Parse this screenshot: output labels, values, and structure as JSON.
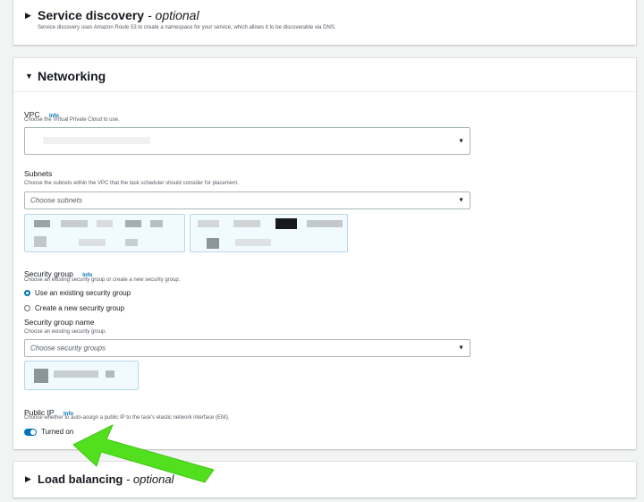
{
  "service_discovery": {
    "title": "Service discovery",
    "optional": "- optional",
    "description": "Service discovery uses Amazon Route 53 to create a namespace for your service, which allows it to be discoverable via DNS."
  },
  "networking": {
    "title": "Networking",
    "vpc": {
      "label": "VPC",
      "info": "Info",
      "description": "Choose the Virtual Private Cloud to use.",
      "value": ""
    },
    "subnets": {
      "label": "Subnets",
      "description": "Choose the subnets within the VPC that the task scheduler should consider for placement.",
      "placeholder": "Choose subnets"
    },
    "security_group": {
      "label": "Security group",
      "info": "Info",
      "description": "Choose an existing security group or create a new security group.",
      "options": [
        "Use an existing security group",
        "Create a new security group"
      ],
      "selected": "Use an existing security group",
      "name_label": "Security group name",
      "name_description": "Choose an existing security group.",
      "placeholder": "Choose security groups"
    },
    "public_ip": {
      "label": "Public IP",
      "info": "Info",
      "description": "Choose whether to auto-assign a public IP to the task's elastic network interface (ENI).",
      "toggle_label": "Turned on",
      "enabled": true
    }
  },
  "load_balancing": {
    "title": "Load balancing",
    "optional": "- optional"
  },
  "colors": {
    "accent": "#0073bb",
    "annotation_arrow": "#52e01e",
    "background": "#f2f3f3"
  }
}
